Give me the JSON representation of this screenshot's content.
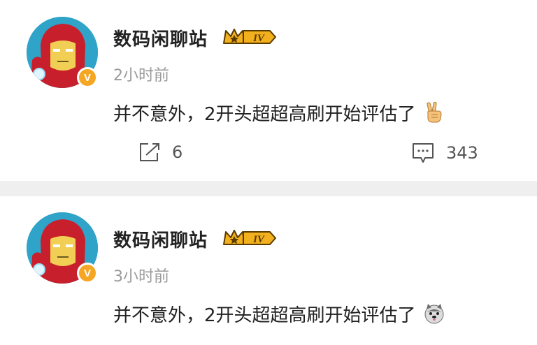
{
  "posts": [
    {
      "author": "数码闲聊站",
      "level_badge": "IV",
      "verified_mark": "V",
      "time": "2小时前",
      "text": "并不意外，2开头超超高刷开始评估了",
      "emoji": "victory-hand-emoji",
      "repost_count": "6",
      "comment_count": "343"
    },
    {
      "author": "数码闲聊站",
      "level_badge": "IV",
      "verified_mark": "V",
      "time": "3小时前",
      "text": "并不意外，2开头超超高刷开始评估了",
      "emoji": "husky-face-emoji"
    }
  ],
  "colors": {
    "background": "#efefef",
    "card": "#ffffff",
    "verified": "#f5a623",
    "crown": "#f2b01e",
    "time": "#9a9a9a"
  }
}
